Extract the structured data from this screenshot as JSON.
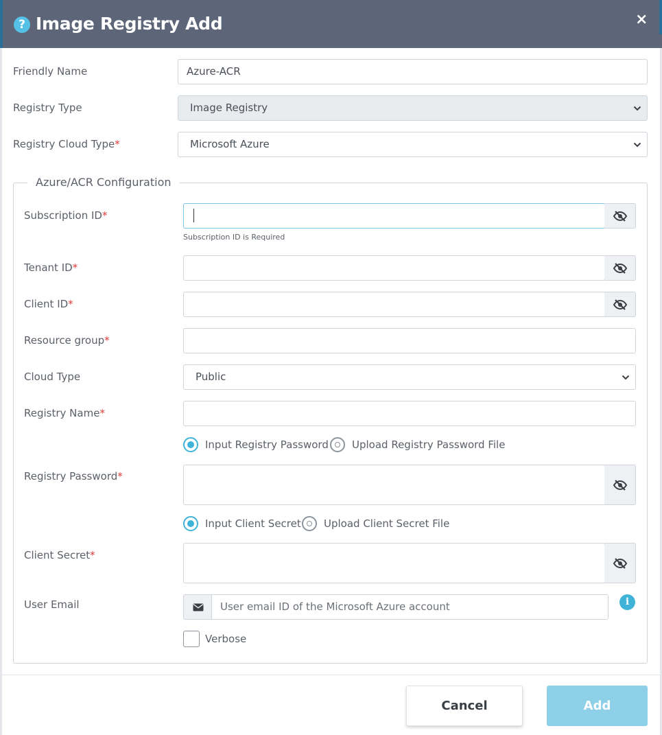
{
  "dialog": {
    "title": "Image Registry Add",
    "help_icon": "question-circle-icon",
    "close_symbol": "×"
  },
  "form": {
    "friendly_name": {
      "label": "Friendly Name",
      "value": "Azure-ACR"
    },
    "registry_type": {
      "label": "Registry Type",
      "value": "Image Registry"
    },
    "registry_cloud_type": {
      "label": "Registry Cloud Type",
      "required": "*",
      "value": "Microsoft Azure"
    }
  },
  "config": {
    "legend": "Azure/ACR Configuration",
    "subscription_id": {
      "label": "Subscription ID",
      "required": "*",
      "value": "",
      "error": "Subscription ID is Required"
    },
    "tenant_id": {
      "label": "Tenant ID",
      "required": "*",
      "value": ""
    },
    "client_id": {
      "label": "Client ID",
      "required": "*",
      "value": ""
    },
    "resource_group": {
      "label": "Resource group",
      "required": "*",
      "value": ""
    },
    "cloud_type": {
      "label": "Cloud Type",
      "value": "Public"
    },
    "registry_name": {
      "label": "Registry Name",
      "required": "*",
      "value": ""
    },
    "password_mode": {
      "option1": "Input Registry Password",
      "option2": "Upload Registry Password File",
      "selected": "Input Registry Password"
    },
    "registry_password": {
      "label": "Registry Password",
      "required": "*",
      "value": ""
    },
    "secret_mode": {
      "option1": "Input Client Secret",
      "option2": "Upload Client Secret File",
      "selected": "Input Client Secret"
    },
    "client_secret": {
      "label": "Client Secret",
      "required": "*",
      "value": ""
    },
    "user_email": {
      "label": "User Email",
      "placeholder": "User email ID of the Microsoft Azure account",
      "value": ""
    },
    "verbose": {
      "label": "Verbose",
      "checked": false
    }
  },
  "footer": {
    "cancel_label": "Cancel",
    "add_label": "Add"
  },
  "colors": {
    "header": "#5d6678",
    "accent": "#3fb4d8",
    "required": "#e03b3b",
    "add_button_disabled": "#8ed0e8"
  }
}
